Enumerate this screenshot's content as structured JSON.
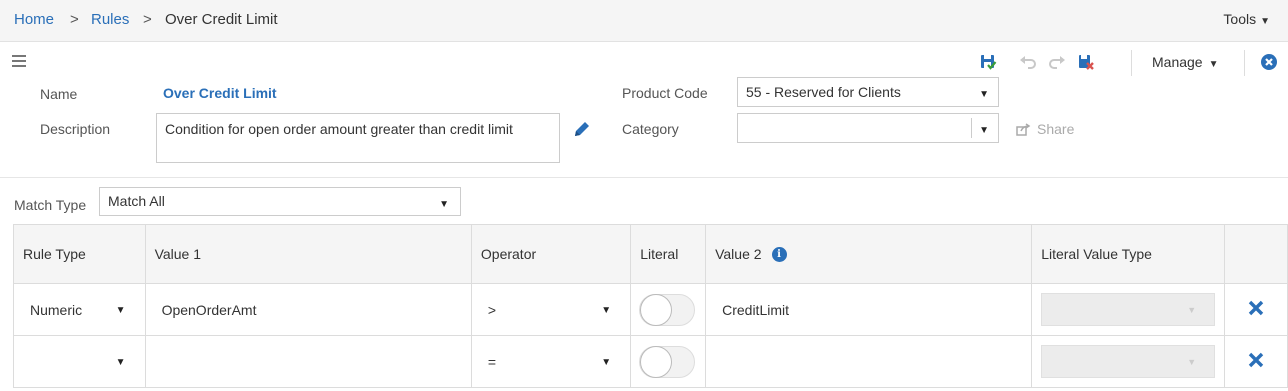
{
  "breadcrumb": {
    "home": "Home",
    "sep1": ">",
    "rules": "Rules",
    "sep2": ">",
    "current": "Over Credit Limit"
  },
  "header": {
    "tools_label": "Tools"
  },
  "toolbar": {
    "icons": [
      "save-icon",
      "undo-icon",
      "redo-icon",
      "delete-icon"
    ],
    "manage_label": "Manage",
    "close_icon": "close-circle-icon"
  },
  "form": {
    "name_label": "Name",
    "name_value": "Over Credit Limit",
    "description_label": "Description",
    "description_value": "Condition for open order amount greater than credit limit",
    "product_code_label": "Product Code",
    "product_code_value": "55 - Reserved for Clients",
    "category_label": "Category",
    "category_value": "",
    "share_label": "Share"
  },
  "match": {
    "label": "Match Type",
    "value": "Match All"
  },
  "table": {
    "headers": [
      "Rule Type",
      "Value 1",
      "Operator",
      "Literal",
      "Value 2",
      "Literal Value Type",
      ""
    ],
    "rows": [
      {
        "rule_type": "Numeric",
        "value1": "OpenOrderAmt",
        "operator": ">",
        "literal": false,
        "value2": "CreditLimit",
        "literal_value_type": ""
      },
      {
        "rule_type": "",
        "value1": "",
        "operator": "=",
        "literal": false,
        "value2": "",
        "literal_value_type": ""
      }
    ]
  },
  "colors": {
    "accent": "#2a6fb8",
    "header_bg": "#f5f5f5",
    "border": "#dcdcdc",
    "delete_red": "#d9534f",
    "save_green": "#3a9d3a"
  }
}
